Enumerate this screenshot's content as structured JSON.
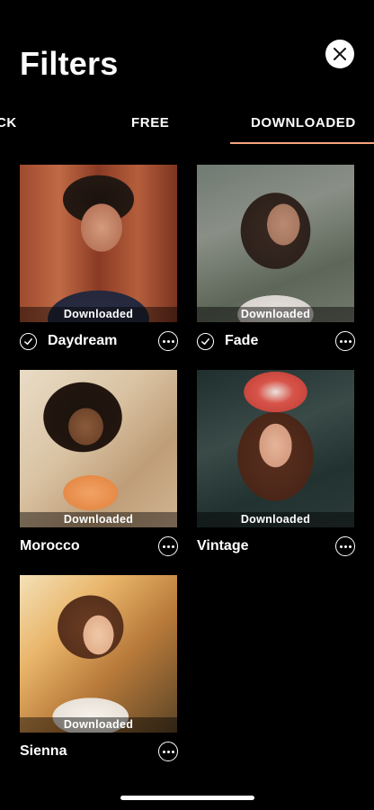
{
  "header": {
    "title": "Filters",
    "close_icon": "close-icon"
  },
  "tabs": {
    "items": [
      {
        "label": "CK"
      },
      {
        "label": "FREE"
      },
      {
        "label": "DOWNLOADED"
      }
    ],
    "active_index": 2,
    "accent_color": "#f5a27a"
  },
  "filters": [
    {
      "name": "Daydream",
      "badge": "Downloaded",
      "checked": true
    },
    {
      "name": "Fade",
      "badge": "Downloaded",
      "checked": true
    },
    {
      "name": "Morocco",
      "badge": "Downloaded",
      "checked": false
    },
    {
      "name": "Vintage",
      "badge": "Downloaded",
      "checked": false
    },
    {
      "name": "Sienna",
      "badge": "Downloaded",
      "checked": false
    }
  ]
}
